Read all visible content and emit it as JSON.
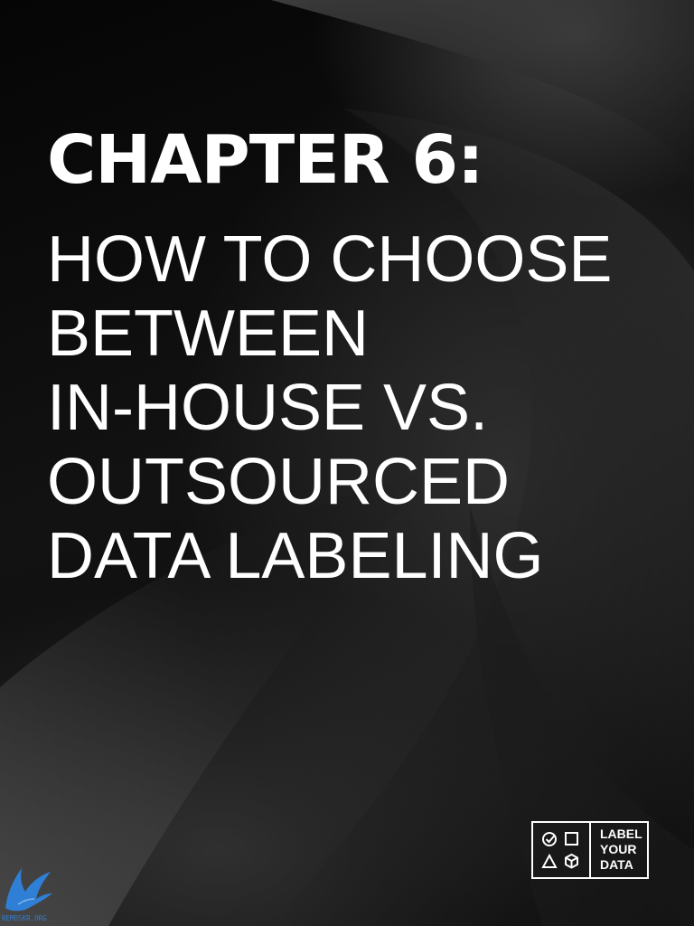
{
  "cover": {
    "chapter": "CHAPTER 6:",
    "subtitle_lines": [
      "HOW TO CHOOSE",
      "BETWEEN",
      "IN-HOUSE VS.",
      "OUTSOURCED",
      "DATA LABELING"
    ]
  },
  "logo": {
    "lines": [
      "LABEL",
      "YOUR",
      "DATA"
    ],
    "icons": [
      "check-circle-icon",
      "square-icon",
      "triangle-icon",
      "cube-icon"
    ]
  },
  "watermark": {
    "icon": "bird-icon",
    "text": "REMOSKR.ORG"
  },
  "colors": {
    "background": "#000000",
    "text": "#ffffff",
    "watermark": "#2f7fd6"
  }
}
